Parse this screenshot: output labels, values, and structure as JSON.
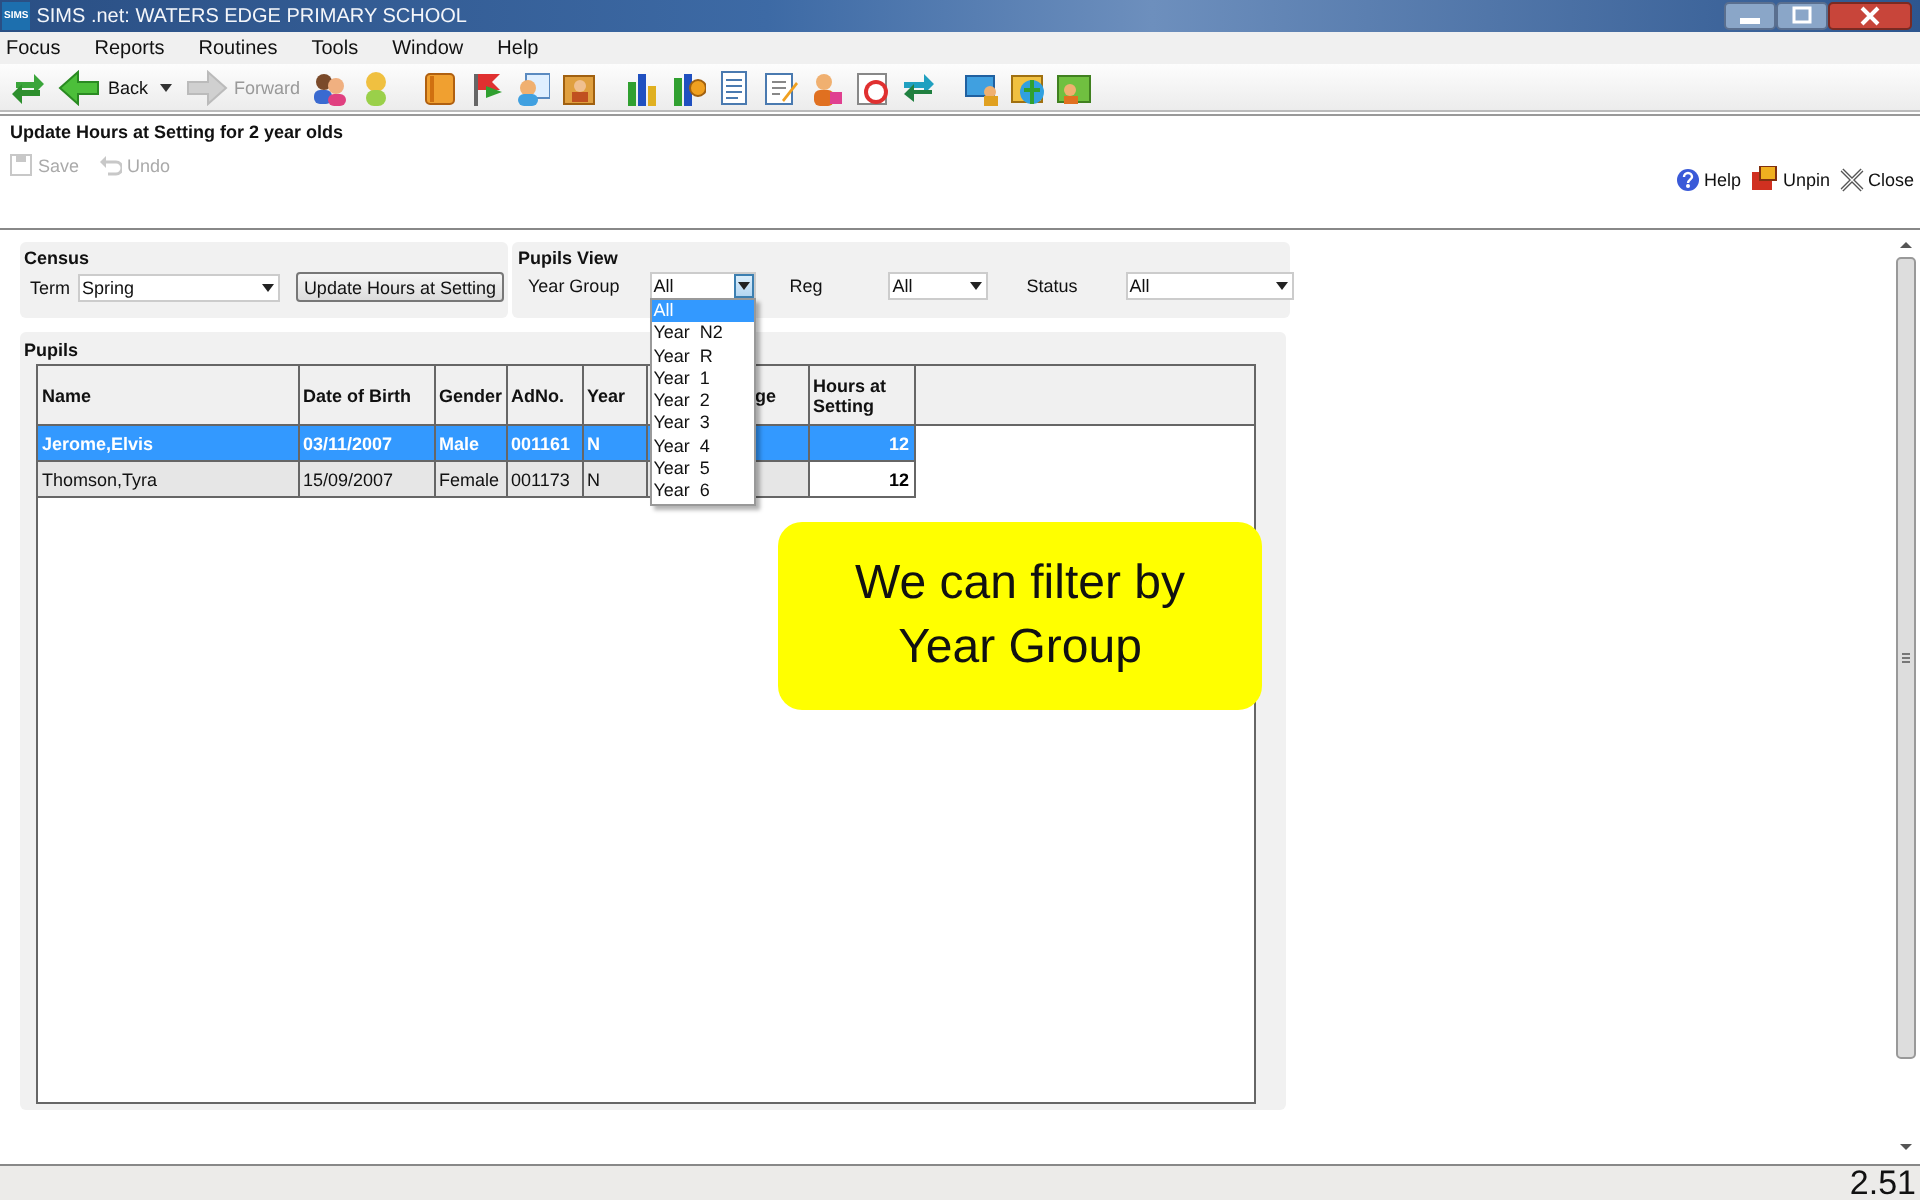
{
  "window": {
    "logo": "SIMS",
    "title": "SIMS .net: WATERS EDGE PRIMARY SCHOOL"
  },
  "menu": [
    "Focus",
    "Reports",
    "Routines",
    "Tools",
    "Window",
    "Help"
  ],
  "toolbar": {
    "back": {
      "label": "Back",
      "disabled": false
    },
    "forward": {
      "label": "Forward",
      "disabled": true
    }
  },
  "page": {
    "title": "Update Hours at Setting for 2 year olds",
    "actions": [
      {
        "label": "Save",
        "disabled": true
      },
      {
        "label": "Undo",
        "disabled": true
      }
    ],
    "links": [
      "Help",
      "Unpin",
      "Close"
    ]
  },
  "census": {
    "title": "Census",
    "term_label": "Term",
    "term": "Spring",
    "button": "Update Hours at Setting"
  },
  "pupils_view": {
    "title": "Pupils View",
    "filters": [
      {
        "label": "Year Group",
        "value": "All",
        "open": true
      },
      {
        "label": "Reg",
        "value": "All",
        "open": false
      },
      {
        "label": "Status",
        "value": "All",
        "open": false
      }
    ],
    "options": [
      {
        "label": "All",
        "selected": true
      },
      {
        "label": "Year  N2",
        "selected": false
      },
      {
        "label": "Year  R",
        "selected": false
      },
      {
        "label": "Year  1",
        "selected": false
      },
      {
        "label": "Year  2",
        "selected": false
      },
      {
        "label": "Year  3",
        "selected": false
      },
      {
        "label": "Year  4",
        "selected": false
      },
      {
        "label": "Year  5",
        "selected": false
      },
      {
        "label": "Year  6",
        "selected": false
      }
    ]
  },
  "pupils": {
    "title": "Pupils",
    "columns": [
      "Name",
      "Date of Birth",
      "Gender",
      "AdNo.",
      "Year",
      "ge",
      "Hours at Setting"
    ],
    "rows": [
      {
        "selected": true,
        "cells": [
          "Jerome,Elvis",
          "03/11/2007",
          "Male",
          "001161",
          "N"
        ],
        "hours": "12"
      },
      {
        "selected": false,
        "cells": [
          "Thomson,Tyra",
          "15/09/2007",
          "Female",
          "001173",
          "N"
        ],
        "hours": "12"
      }
    ]
  },
  "callout": "We can filter by Year Group",
  "slide_number": "2.51"
}
